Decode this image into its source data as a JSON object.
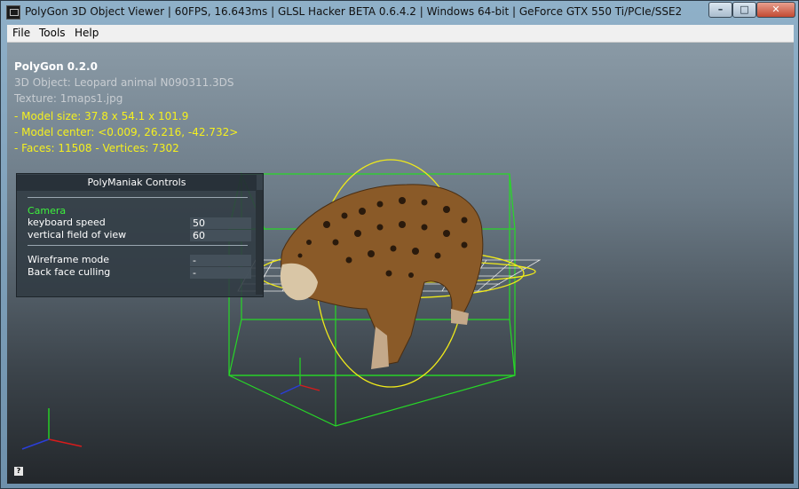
{
  "window": {
    "title": "PolyGon 3D Object Viewer | 60FPS, 16.643ms | GLSL Hacker BETA 0.6.4.2 | Windows 64-bit | GeForce GTX 550 Ti/PCIe/SSE2",
    "min_glyph": "–",
    "max_glyph": "□",
    "close_glyph": "✕"
  },
  "menu": {
    "file": "File",
    "tools": "Tools",
    "help": "Help"
  },
  "info": {
    "title": "PolyGon 0.2.0",
    "object": "3D Object: Leopard animal N090311.3DS",
    "texture": "Texture: 1maps1.jpg",
    "model_size": "- Model size:  37.8 x 54.1 x 101.9",
    "model_center": "- Model center:  <0.009, 26.216, -42.732>",
    "faces_vertices": "- Faces: 11508 - Vertices: 7302"
  },
  "controls": {
    "title": "PolyManiak Controls",
    "section_camera": "Camera",
    "keyboard_speed_label": "keyboard speed",
    "keyboard_speed_value": "50",
    "fov_label": "vertical field of view",
    "fov_value": "60",
    "wireframe_label": "Wireframe mode",
    "wireframe_value": "-",
    "backface_label": "Back face culling",
    "backface_value": "-"
  },
  "help_icon_glyph": "?",
  "colors": {
    "info_yellow": "#f5f01e",
    "camera_green": "#3df23d",
    "bbox_green": "#27d827",
    "gizmo_yellow": "#f0ea1a",
    "axis_x": "#d81b1b",
    "axis_y": "#27c427",
    "axis_z": "#2a3ed8"
  },
  "icons": {
    "app": "app-icon",
    "minimize": "minimize-icon",
    "maximize": "maximize-icon",
    "close": "close-icon",
    "help": "help-icon"
  }
}
